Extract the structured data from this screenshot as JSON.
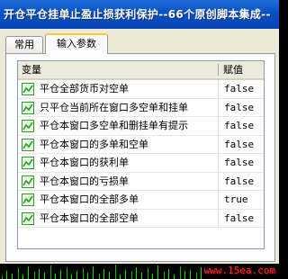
{
  "window": {
    "title": "开仓平仓挂单止盈止损获利保护--66个原创脚本集成--"
  },
  "tabs": [
    {
      "label": "常用"
    },
    {
      "label": "输入参数"
    }
  ],
  "table": {
    "columns": [
      "变量",
      "赋值"
    ],
    "rows": [
      {
        "label": "平仓全部货币对空单",
        "value": "false"
      },
      {
        "label": "只平仓当前所在窗口多空单和挂单",
        "value": "false"
      },
      {
        "label": "平仓本窗口多空单和删挂单有提示",
        "value": "false"
      },
      {
        "label": "平仓本窗口的多单和空单",
        "value": "false"
      },
      {
        "label": "平仓本窗口的获利单",
        "value": "false"
      },
      {
        "label": "平仓本窗口的亏损单",
        "value": "false"
      },
      {
        "label": "平仓本窗口的全部多单",
        "value": "true"
      },
      {
        "label": "平仓本窗口的全部空单",
        "value": "false"
      }
    ]
  },
  "watermark": "www.15ea.com",
  "colors": {
    "titlebar": "#0a4fc4",
    "dialog": "#ece9d8",
    "watermark": "#ff2a2a",
    "icon_green": "#2e9b2e"
  },
  "icons": {
    "row_icon": "parameter-graph-icon"
  }
}
